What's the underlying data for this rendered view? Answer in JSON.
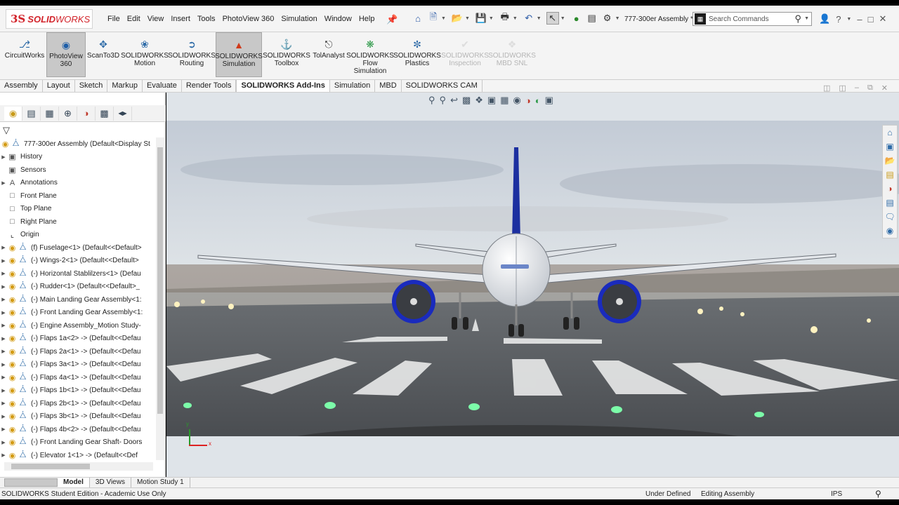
{
  "app": {
    "logo_ds": "3S",
    "logo_solid": "SOLID",
    "logo_works": "WORKS",
    "document_title": "777-300er Assembly *"
  },
  "menu": [
    "File",
    "Edit",
    "View",
    "Insert",
    "Tools",
    "PhotoView 360",
    "Simulation",
    "Window",
    "Help"
  ],
  "search": {
    "placeholder": "Search Commands"
  },
  "toolbar": [
    {
      "l1": "CircuitWorks",
      "l2": "",
      "l3": ""
    },
    {
      "l1": "PhotoView",
      "l2": "360",
      "l3": ""
    },
    {
      "l1": "ScanTo3D",
      "l2": "",
      "l3": ""
    },
    {
      "l1": "SOLIDWORKS",
      "l2": "Motion",
      "l3": ""
    },
    {
      "l1": "SOLIDWORKS",
      "l2": "Routing",
      "l3": ""
    },
    {
      "l1": "SOLIDWORKS",
      "l2": "Simulation",
      "l3": ""
    },
    {
      "l1": "SOLIDWORKS",
      "l2": "Toolbox",
      "l3": ""
    },
    {
      "l1": "TolAnalyst",
      "l2": "",
      "l3": ""
    },
    {
      "l1": "SOLIDWORKS",
      "l2": "Flow",
      "l3": "Simulation"
    },
    {
      "l1": "SOLIDWORKS",
      "l2": "Plastics",
      "l3": ""
    },
    {
      "l1": "SOLIDWORKS",
      "l2": "Inspection",
      "l3": ""
    },
    {
      "l1": "SOLIDWORKS",
      "l2": "MBD SNL",
      "l3": ""
    }
  ],
  "tabs": [
    "Assembly",
    "Layout",
    "Sketch",
    "Markup",
    "Evaluate",
    "Render Tools",
    "SOLIDWORKS Add-Ins",
    "Simulation",
    "MBD",
    "SOLIDWORKS CAM"
  ],
  "tree": {
    "root": "777-300er Assembly  (Default<Display St",
    "items": [
      "History",
      "Sensors",
      "Annotations",
      "Front Plane",
      "Top Plane",
      "Right Plane",
      "Origin",
      "(f) Fuselage<1> (Default<<Default>",
      "(-) Wings-2<1> (Default<<Default>",
      "(-) Horizontal Stablilzers<1> (Defau",
      "(-) Rudder<1> (Default<<Default>_",
      "(-) Main Landing Gear Assembly<1:",
      "(-) Front Landing Gear Assembly<1:",
      "(-) Engine Assembly_Motion Study-",
      "(-) Flaps 1a<2> -> (Default<<Defau",
      "(-) Flaps 2a<1> -> (Default<<Defau",
      "(-) Flaps 3a<1> -> (Default<<Defau",
      "(-) Flaps 4a<1> -> (Default<<Defau",
      "(-) Flaps 1b<1> -> (Default<<Defau",
      "(-) Flaps 2b<1> -> (Default<<Defau",
      "(-) Flaps 3b<1> -> (Default<<Defau",
      "(-) Flaps 4b<2> -> (Default<<Defau",
      "(-) Front Landing Gear Shaft- Doors",
      "(-) Elevator 1<1> -> (Default<<Def"
    ]
  },
  "bottom_tabs": [
    "Model",
    "3D Views",
    "Motion Study 1"
  ],
  "status": {
    "edition": "SOLIDWORKS Student Edition - Academic Use Only",
    "defined": "Under Defined",
    "editing": "Editing Assembly",
    "units": "IPS"
  },
  "triad": {
    "x": "x",
    "y": "y"
  },
  "colors": {
    "brand_red": "#d2232a",
    "tail_blue": "#1c2fa0",
    "engine_blue": "#1a2bbd",
    "active_tool": "#c8c8c8"
  }
}
